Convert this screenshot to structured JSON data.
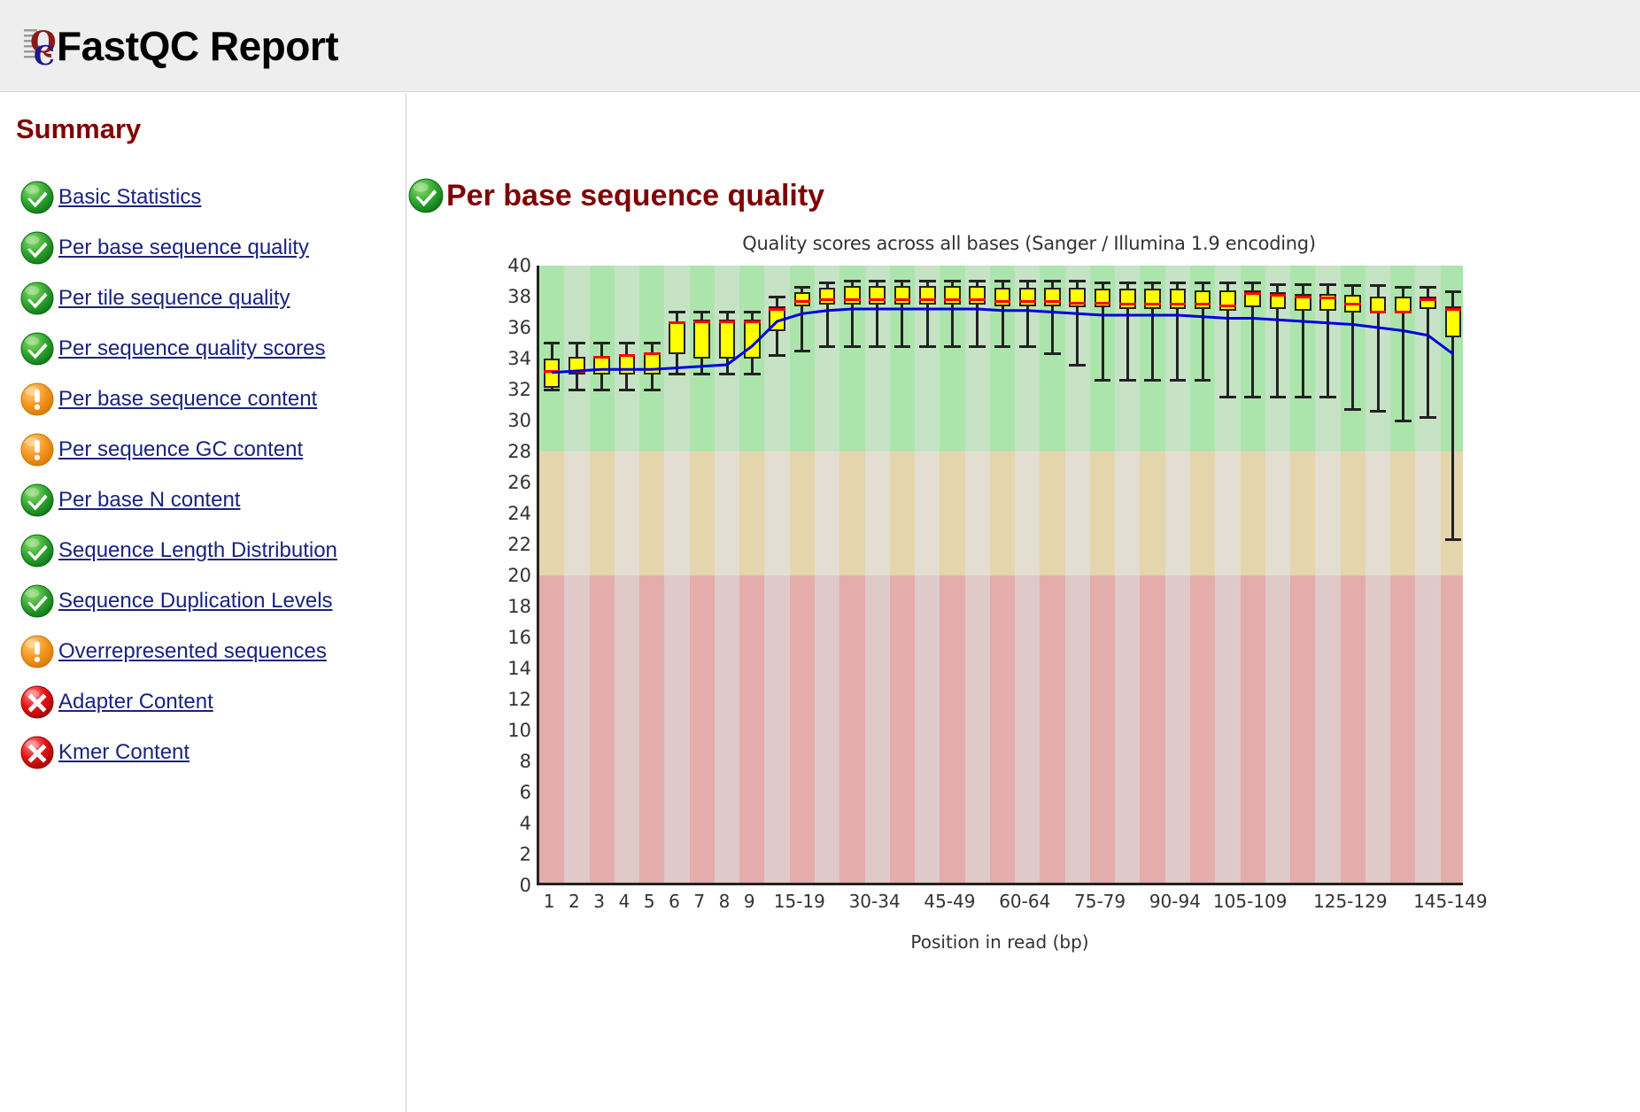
{
  "header": {
    "app_title": "FastQC Report",
    "logo_icon": "fastqc-logo-icon"
  },
  "sidebar": {
    "title": "Summary",
    "items": [
      {
        "label": "Basic Statistics",
        "status": "pass",
        "icon": "check-circle-icon"
      },
      {
        "label": "Per base sequence quality",
        "status": "pass",
        "icon": "check-circle-icon"
      },
      {
        "label": "Per tile sequence quality",
        "status": "pass",
        "icon": "check-circle-icon"
      },
      {
        "label": "Per sequence quality scores",
        "status": "pass",
        "icon": "check-circle-icon"
      },
      {
        "label": "Per base sequence content",
        "status": "warn",
        "icon": "warning-circle-icon"
      },
      {
        "label": "Per sequence GC content",
        "status": "warn",
        "icon": "warning-circle-icon"
      },
      {
        "label": "Per base N content",
        "status": "pass",
        "icon": "check-circle-icon"
      },
      {
        "label": "Sequence Length Distribution",
        "status": "pass",
        "icon": "check-circle-icon"
      },
      {
        "label": "Sequence Duplication Levels",
        "status": "pass",
        "icon": "check-circle-icon"
      },
      {
        "label": "Overrepresented sequences",
        "status": "warn",
        "icon": "warning-circle-icon"
      },
      {
        "label": "Adapter Content",
        "status": "fail",
        "icon": "error-circle-icon"
      },
      {
        "label": "Kmer Content",
        "status": "fail",
        "icon": "error-circle-icon"
      }
    ]
  },
  "main": {
    "module_title": "Per base sequence quality",
    "module_status": "pass",
    "module_icon": "check-circle-icon"
  },
  "colors": {
    "title_maroon": "#800000",
    "link_blue": "#1a237e",
    "pass_green": "#2ea82e",
    "warn_orange": "#f59824",
    "fail_red": "#e00000",
    "band_good": "#ace5ac",
    "band_good_alt": "#c6e3c6",
    "band_mid": "#e5d5ac",
    "band_mid_alt": "#e3ded1",
    "band_bad": "#e5acac",
    "band_bad_alt": "#e0c9c9",
    "box_fill": "#ffff00",
    "box_stroke": "#222222",
    "median": "#ff0000",
    "mean": "#0000dd"
  },
  "chart_data": {
    "type": "boxplot",
    "title": "Quality scores across all bases (Sanger / Illumina 1.9 encoding)",
    "xlabel": "Position in read (bp)",
    "ylabel": "",
    "ylim": [
      0,
      40
    ],
    "ytick_step": 2,
    "yticks": [
      0,
      2,
      4,
      6,
      8,
      10,
      12,
      14,
      16,
      18,
      20,
      22,
      24,
      26,
      28,
      30,
      32,
      34,
      36,
      38,
      40
    ],
    "grid": false,
    "legend": "none",
    "background_bands": [
      {
        "label": "good",
        "from": 28,
        "to": 40,
        "color": "#ace5ac"
      },
      {
        "label": "warning",
        "from": 20,
        "to": 28,
        "color": "#e5d5ac"
      },
      {
        "label": "bad",
        "from": 0,
        "to": 20,
        "color": "#e5acac"
      }
    ],
    "categories": [
      "1",
      "2",
      "3",
      "4",
      "5",
      "6",
      "7",
      "8",
      "9",
      "10-14",
      "15-19",
      "20-24",
      "25-29",
      "30-34",
      "35-39",
      "40-44",
      "45-49",
      "50-54",
      "55-59",
      "60-64",
      "65-69",
      "70-74",
      "75-79",
      "80-84",
      "85-89",
      "90-94",
      "95-99",
      "100-104",
      "105-109",
      "110-114",
      "115-119",
      "120-124",
      "125-129",
      "130-134",
      "135-139",
      "140-144",
      "145-149"
    ],
    "xtick_labels": [
      "1",
      "2",
      "3",
      "4",
      "5",
      "6",
      "7",
      "8",
      "9",
      "15-19",
      "30-34",
      "45-49",
      "60-64",
      "75-79",
      "90-94",
      "105-109",
      "125-129",
      "145-149"
    ],
    "boxes": [
      {
        "category": "1",
        "lower_whisker": 32.0,
        "q1": 32.1,
        "median": 33.2,
        "q3": 34.0,
        "upper_whisker": 35.0
      },
      {
        "category": "2",
        "lower_whisker": 32.0,
        "q1": 33.0,
        "median": 33.2,
        "q3": 34.1,
        "upper_whisker": 35.0
      },
      {
        "category": "3",
        "lower_whisker": 32.0,
        "q1": 33.0,
        "median": 34.1,
        "q3": 34.2,
        "upper_whisker": 35.0
      },
      {
        "category": "4",
        "lower_whisker": 32.0,
        "q1": 33.0,
        "median": 34.2,
        "q3": 34.3,
        "upper_whisker": 35.0
      },
      {
        "category": "5",
        "lower_whisker": 32.0,
        "q1": 33.0,
        "median": 34.3,
        "q3": 34.4,
        "upper_whisker": 35.0
      },
      {
        "category": "6",
        "lower_whisker": 33.0,
        "q1": 34.3,
        "median": 36.3,
        "q3": 36.4,
        "upper_whisker": 37.0
      },
      {
        "category": "7",
        "lower_whisker": 33.0,
        "q1": 34.0,
        "median": 36.4,
        "q3": 36.5,
        "upper_whisker": 37.0
      },
      {
        "category": "8",
        "lower_whisker": 33.0,
        "q1": 34.0,
        "median": 36.4,
        "q3": 36.5,
        "upper_whisker": 37.0
      },
      {
        "category": "9",
        "lower_whisker": 33.0,
        "q1": 34.0,
        "median": 36.4,
        "q3": 36.5,
        "upper_whisker": 37.0
      },
      {
        "category": "10-14",
        "lower_whisker": 34.2,
        "q1": 35.8,
        "median": 37.2,
        "q3": 37.4,
        "upper_whisker": 38.0
      },
      {
        "category": "15-19",
        "lower_whisker": 34.5,
        "q1": 37.4,
        "median": 37.7,
        "q3": 38.3,
        "upper_whisker": 38.6
      },
      {
        "category": "20-24",
        "lower_whisker": 34.8,
        "q1": 37.5,
        "median": 37.8,
        "q3": 38.6,
        "upper_whisker": 38.9
      },
      {
        "category": "25-29",
        "lower_whisker": 34.8,
        "q1": 37.5,
        "median": 37.8,
        "q3": 38.7,
        "upper_whisker": 39.0
      },
      {
        "category": "30-34",
        "lower_whisker": 34.8,
        "q1": 37.5,
        "median": 37.8,
        "q3": 38.7,
        "upper_whisker": 39.0
      },
      {
        "category": "35-39",
        "lower_whisker": 34.8,
        "q1": 37.5,
        "median": 37.8,
        "q3": 38.7,
        "upper_whisker": 39.0
      },
      {
        "category": "40-44",
        "lower_whisker": 34.8,
        "q1": 37.5,
        "median": 37.8,
        "q3": 38.7,
        "upper_whisker": 39.0
      },
      {
        "category": "45-49",
        "lower_whisker": 34.8,
        "q1": 37.5,
        "median": 37.8,
        "q3": 38.7,
        "upper_whisker": 39.0
      },
      {
        "category": "50-54",
        "lower_whisker": 34.8,
        "q1": 37.5,
        "median": 37.8,
        "q3": 38.7,
        "upper_whisker": 39.0
      },
      {
        "category": "55-59",
        "lower_whisker": 34.8,
        "q1": 37.4,
        "median": 37.7,
        "q3": 38.6,
        "upper_whisker": 39.0
      },
      {
        "category": "60-64",
        "lower_whisker": 34.8,
        "q1": 37.4,
        "median": 37.7,
        "q3": 38.6,
        "upper_whisker": 39.0
      },
      {
        "category": "65-69",
        "lower_whisker": 34.3,
        "q1": 37.4,
        "median": 37.7,
        "q3": 38.6,
        "upper_whisker": 39.0
      },
      {
        "category": "70-74",
        "lower_whisker": 33.6,
        "q1": 37.3,
        "median": 37.6,
        "q3": 38.6,
        "upper_whisker": 39.0
      },
      {
        "category": "75-79",
        "lower_whisker": 32.6,
        "q1": 37.3,
        "median": 37.6,
        "q3": 38.5,
        "upper_whisker": 38.9
      },
      {
        "category": "80-84",
        "lower_whisker": 32.6,
        "q1": 37.2,
        "median": 37.5,
        "q3": 38.5,
        "upper_whisker": 38.9
      },
      {
        "category": "85-89",
        "lower_whisker": 32.6,
        "q1": 37.2,
        "median": 37.5,
        "q3": 38.5,
        "upper_whisker": 38.9
      },
      {
        "category": "90-94",
        "lower_whisker": 32.6,
        "q1": 37.2,
        "median": 37.5,
        "q3": 38.5,
        "upper_whisker": 38.9
      },
      {
        "category": "95-99",
        "lower_whisker": 32.6,
        "q1": 37.2,
        "median": 37.5,
        "q3": 38.4,
        "upper_whisker": 38.9
      },
      {
        "category": "100-104",
        "lower_whisker": 31.5,
        "q1": 37.1,
        "median": 37.4,
        "q3": 38.4,
        "upper_whisker": 38.9
      },
      {
        "category": "105-109",
        "lower_whisker": 31.5,
        "q1": 37.3,
        "median": 38.2,
        "q3": 38.4,
        "upper_whisker": 38.9
      },
      {
        "category": "110-114",
        "lower_whisker": 31.5,
        "q1": 37.2,
        "median": 38.1,
        "q3": 38.3,
        "upper_whisker": 38.8
      },
      {
        "category": "115-119",
        "lower_whisker": 31.5,
        "q1": 37.1,
        "median": 38.0,
        "q3": 38.2,
        "upper_whisker": 38.8
      },
      {
        "category": "120-124",
        "lower_whisker": 31.5,
        "q1": 37.1,
        "median": 37.9,
        "q3": 38.2,
        "upper_whisker": 38.8
      },
      {
        "category": "125-129",
        "lower_whisker": 30.7,
        "q1": 37.0,
        "median": 37.5,
        "q3": 38.1,
        "upper_whisker": 38.7
      },
      {
        "category": "130-134",
        "lower_whisker": 30.6,
        "q1": 36.9,
        "median": 37.0,
        "q3": 38.0,
        "upper_whisker": 38.7
      },
      {
        "category": "135-139",
        "lower_whisker": 30.0,
        "q1": 36.9,
        "median": 37.0,
        "q3": 38.0,
        "upper_whisker": 38.6
      },
      {
        "category": "140-144",
        "lower_whisker": 30.2,
        "q1": 37.2,
        "median": 37.8,
        "q3": 38.0,
        "upper_whisker": 38.6
      },
      {
        "category": "145-149",
        "lower_whisker": 22.3,
        "q1": 35.4,
        "median": 37.2,
        "q3": 37.4,
        "upper_whisker": 38.3
      }
    ],
    "mean_series": {
      "name": "Mean quality",
      "color": "#0000dd",
      "values": [
        33.1,
        33.2,
        33.3,
        33.3,
        33.3,
        33.4,
        33.5,
        33.6,
        34.8,
        36.4,
        36.9,
        37.1,
        37.2,
        37.2,
        37.2,
        37.2,
        37.2,
        37.2,
        37.1,
        37.1,
        37.0,
        36.9,
        36.8,
        36.8,
        36.8,
        36.8,
        36.7,
        36.6,
        36.6,
        36.5,
        36.4,
        36.3,
        36.2,
        36.0,
        35.8,
        35.5,
        34.3
      ]
    }
  }
}
